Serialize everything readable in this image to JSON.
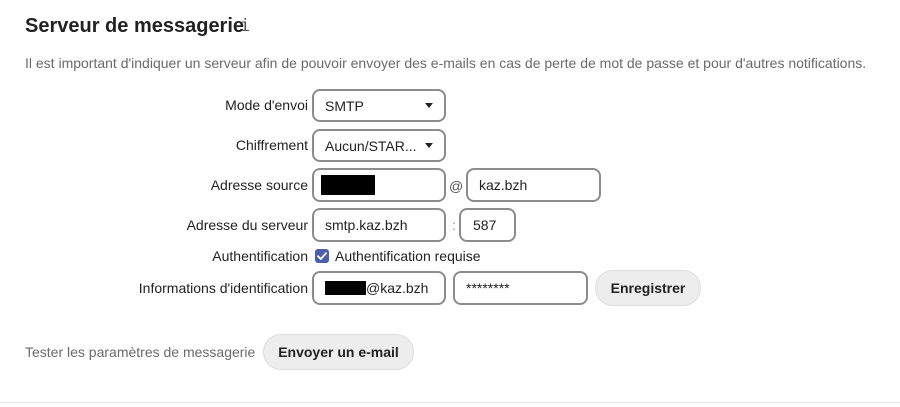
{
  "section": {
    "title": "Serveur de messagerie",
    "info_icon": "info-icon",
    "description": "Il est important d'indiquer un serveur afin de pouvoir envoyer des e-mails en cas de perte de mot de passe et pour d'autres notifications."
  },
  "form": {
    "send_mode": {
      "label": "Mode d'envoi",
      "value": "SMTP"
    },
    "encryption": {
      "label": "Chiffrement",
      "value": "Aucun/STAR..."
    },
    "source_address": {
      "label": "Adresse source",
      "at_symbol": "@",
      "domain": "kaz.bzh"
    },
    "server_address": {
      "label": "Adresse du serveur",
      "host": "smtp.kaz.bzh",
      "separator": ":",
      "port": "587"
    },
    "authentication": {
      "label": "Authentification",
      "checkbox_label": "Authentification requise",
      "checked": true
    },
    "credentials": {
      "label": "Informations d'identification",
      "username_suffix": "@kaz.bzh",
      "password": "********",
      "save_label": "Enregistrer"
    }
  },
  "test": {
    "label": "Tester les paramètres de messagerie",
    "button_label": "Envoyer un e-mail"
  },
  "colors": {
    "accent": "#4a5fa8",
    "field_border": "#8c8c8c",
    "button_bg": "#ededed",
    "muted_text": "#6a6a6a"
  }
}
